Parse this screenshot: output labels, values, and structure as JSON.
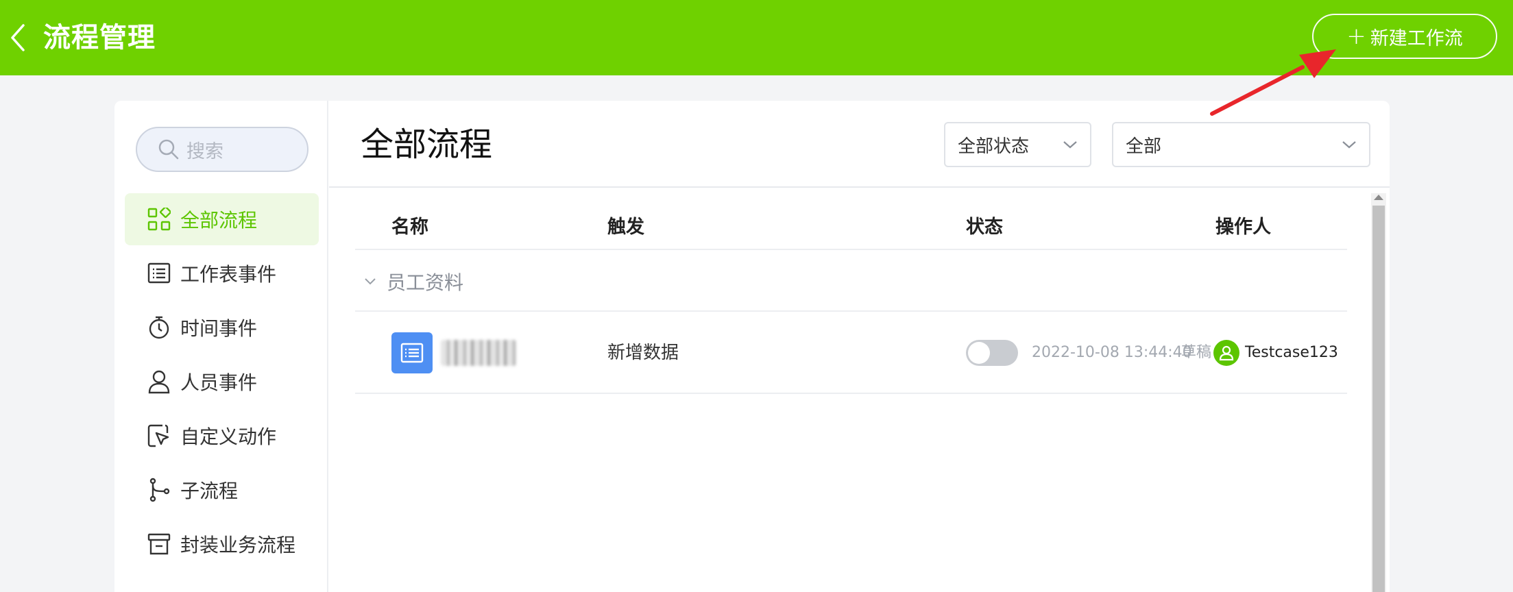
{
  "header": {
    "title": "流程管理",
    "back_icon": "chevron-left-icon",
    "new_button": {
      "plus": "+",
      "label": "新建工作流"
    },
    "bg_color": "#6fd100"
  },
  "sidebar": {
    "search": {
      "placeholder": "搜索",
      "icon": "search-icon"
    },
    "items": [
      {
        "label": "全部流程",
        "icon": "grid-icon",
        "active": true
      },
      {
        "label": "工作表事件",
        "icon": "list-icon",
        "active": false
      },
      {
        "label": "时间事件",
        "icon": "stopwatch-icon",
        "active": false
      },
      {
        "label": "人员事件",
        "icon": "user-icon",
        "active": false
      },
      {
        "label": "自定义动作",
        "icon": "cursor-click-icon",
        "active": false
      },
      {
        "label": "子流程",
        "icon": "branch-icon",
        "active": false
      },
      {
        "label": "封装业务流程",
        "icon": "archive-icon",
        "active": false
      }
    ],
    "active_color": "#5cc500"
  },
  "main": {
    "title": "全部流程",
    "status_filter": {
      "value": "全部状态"
    },
    "scope_filter": {
      "value": "全部"
    },
    "table": {
      "headers": {
        "name": "名称",
        "trigger": "触发",
        "status": "状态",
        "operator": "操作人"
      },
      "groups": [
        {
          "label": "员工资料",
          "rows": [
            {
              "name": "（已模糊）",
              "trigger": "新增数据",
              "enabled": false,
              "datetime": "2022-10-08 13:44:40",
              "status_text": "草稿",
              "operator": "Testcase123"
            }
          ]
        }
      ]
    }
  },
  "annotation": {
    "arrow_color": "#e8262b"
  }
}
